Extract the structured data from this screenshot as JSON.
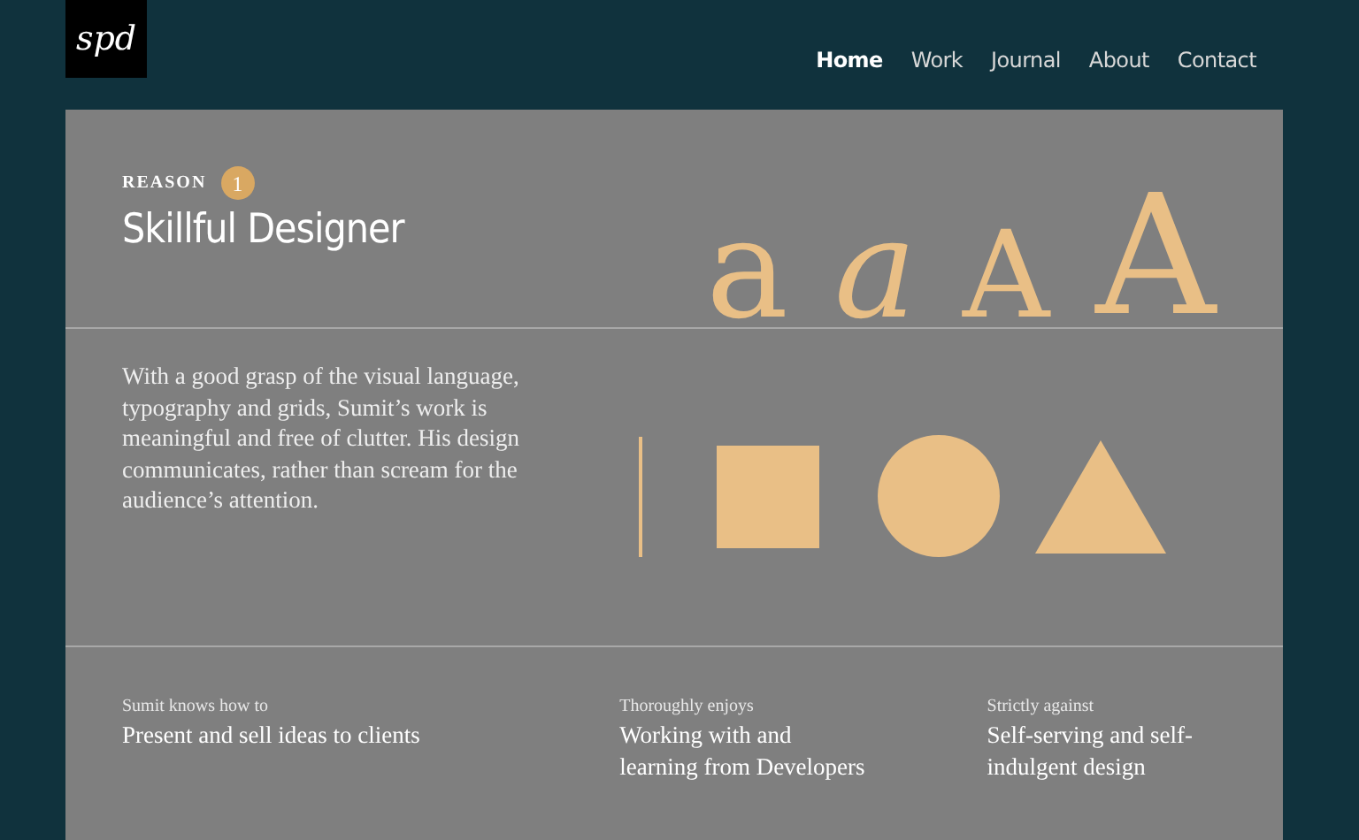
{
  "logo": "spd",
  "nav": [
    {
      "label": "Home",
      "selected": true
    },
    {
      "label": "Work",
      "selected": false
    },
    {
      "label": "Journal",
      "selected": false
    },
    {
      "label": "About",
      "selected": false
    },
    {
      "label": "Contact",
      "selected": false
    }
  ],
  "reason": {
    "label": "REASON",
    "number": "1",
    "title": "Skillful Designer",
    "description": "With a good grasp of the visual language, typography and grids, Sumit’s work is meaningful and free of clutter. His design communicates, rather than scream for the audience’s attention."
  },
  "specimens": [
    {
      "text": "a",
      "kind": "roman"
    },
    {
      "text": "a",
      "kind": "italic"
    },
    {
      "text": "A",
      "kind": "small"
    },
    {
      "text": "A",
      "kind": "large"
    }
  ],
  "facts": [
    {
      "caption": "Sumit knows how to",
      "text": "Present and sell ideas to clients"
    },
    {
      "caption": "Thoroughly enjoys",
      "text": "Working with and learning  from Developers"
    },
    {
      "caption": "Strictly against",
      "text": "Self-serving and self-indulgent design"
    }
  ]
}
